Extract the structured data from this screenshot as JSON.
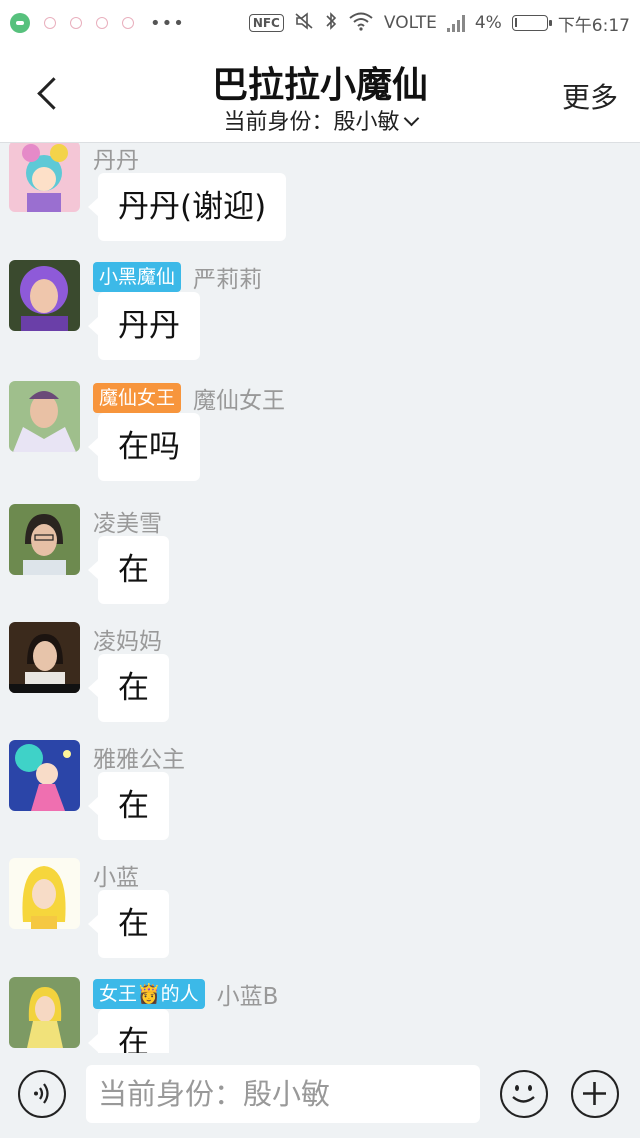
{
  "statusbar": {
    "nfc": "NFC",
    "volte": "VOLTE",
    "battery": "4%",
    "battery_level": 0.04,
    "time": "下午6:17"
  },
  "header": {
    "title": "巴拉拉小魔仙",
    "identity_label": "当前身份：殷小敏",
    "more": "更多"
  },
  "messages": [
    {
      "badge": "",
      "badge_color": "",
      "sender": "丹丹",
      "text": "丹丹(谢迎)"
    },
    {
      "badge": "小黑魔仙",
      "badge_color": "#3cb9e8",
      "sender": "严莉莉",
      "text": "丹丹"
    },
    {
      "badge": "魔仙女王",
      "badge_color": "#f7953c",
      "sender": "魔仙女王",
      "text": "在吗"
    },
    {
      "badge": "",
      "badge_color": "",
      "sender": "凌美雪",
      "text": "在"
    },
    {
      "badge": "",
      "badge_color": "",
      "sender": "凌妈妈",
      "text": "在"
    },
    {
      "badge": "",
      "badge_color": "",
      "sender": "雅雅公主",
      "text": "在"
    },
    {
      "badge": "",
      "badge_color": "",
      "sender": "小蓝",
      "text": "在"
    },
    {
      "badge": "女王👸的人",
      "badge_color": "#3cb9e8",
      "sender": "小蓝B",
      "text": "在"
    }
  ],
  "input": {
    "placeholder": "当前身份：殷小敏"
  },
  "icons": {
    "back": "chevron-left-icon",
    "voice": "voice-icon",
    "emoji": "smiley-icon",
    "plus": "plus-icon"
  }
}
